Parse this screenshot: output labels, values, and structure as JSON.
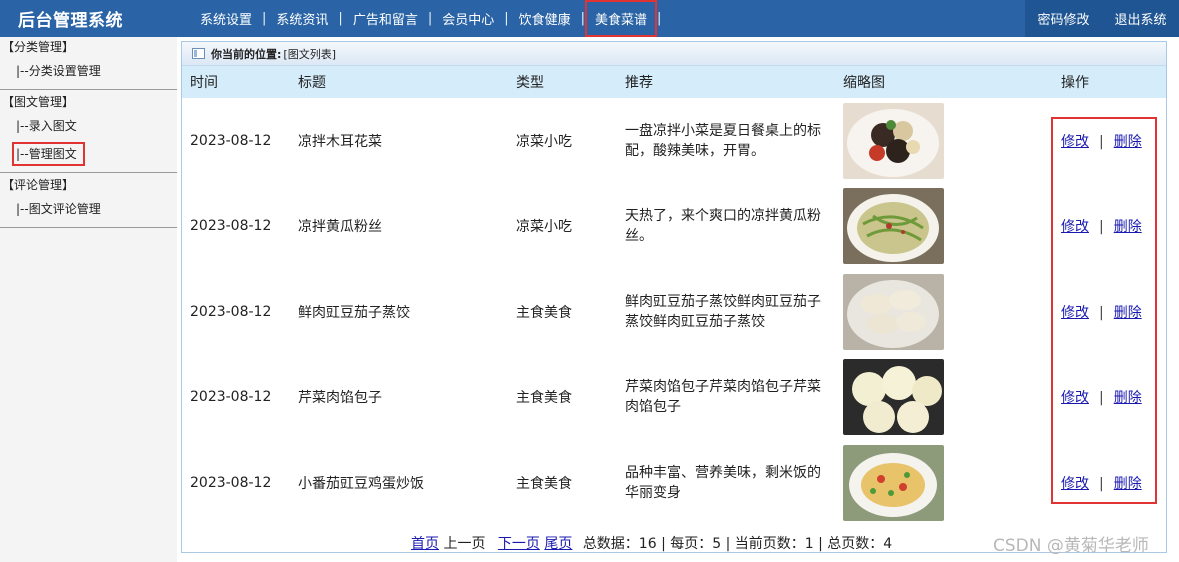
{
  "header": {
    "brand": "后台管理系统",
    "nav": [
      "系统设置",
      "系统资讯",
      "广告和留言",
      "会员中心",
      "饮食健康",
      "美食菜谱"
    ],
    "active_nav": "美食菜谱",
    "right_links": [
      "密码修改",
      "退出系统"
    ]
  },
  "sidebar": {
    "groups": [
      {
        "title": "【分类管理】",
        "items": [
          "|--分类设置管理"
        ]
      },
      {
        "title": "【图文管理】",
        "items": [
          "|--录入图文",
          "|--管理图文"
        ]
      },
      {
        "title": "【评论管理】",
        "items": [
          "|--图文评论管理"
        ]
      }
    ],
    "active_item": "|--管理图文"
  },
  "breadcrumb": {
    "label": "你当前的位置:",
    "value": "[图文列表]"
  },
  "table": {
    "columns": [
      "时间",
      "标题",
      "类型",
      "推荐",
      "缩略图",
      "操作"
    ],
    "rows": [
      {
        "date": "2023-08-12",
        "title": "凉拌木耳花菜",
        "type": "凉菜小吃",
        "rec": "一盘凉拌小菜是夏日餐桌上的标配，酸辣美味，开胃。",
        "edit": "修改",
        "sep": "|",
        "del": "删除"
      },
      {
        "date": "2023-08-12",
        "title": "凉拌黄瓜粉丝",
        "type": "凉菜小吃",
        "rec": "天热了，来个爽口的凉拌黄瓜粉丝。",
        "edit": "修改",
        "sep": "|",
        "del": "删除"
      },
      {
        "date": "2023-08-12",
        "title": "鲜肉豇豆茄子蒸饺",
        "type": "主食美食",
        "rec": "鲜肉豇豆茄子蒸饺鲜肉豇豆茄子蒸饺鲜肉豇豆茄子蒸饺",
        "edit": "修改",
        "sep": "|",
        "del": "删除"
      },
      {
        "date": "2023-08-12",
        "title": "芹菜肉馅包子",
        "type": "主食美食",
        "rec": "芹菜肉馅包子芹菜肉馅包子芹菜肉馅包子",
        "edit": "修改",
        "sep": "|",
        "del": "删除"
      },
      {
        "date": "2023-08-12",
        "title": "小番茄豇豆鸡蛋炒饭",
        "type": "主食美食",
        "rec": "品种丰富、营养美味，剩米饭的华丽变身",
        "edit": "修改",
        "sep": "|",
        "del": "删除"
      }
    ]
  },
  "pager": {
    "first": "首页",
    "prev": "上一页",
    "next": "下一页",
    "last": "尾页",
    "summary": "总数据：16 | 每页：5 | 当前页数：1 | 总页数：4"
  },
  "watermark": "CSDN @黄菊华老师",
  "colors": {
    "topbar": "#2a64a6",
    "highlight": "#e03333",
    "table_header": "#d5ecfb",
    "link": "#1a1ab0"
  }
}
